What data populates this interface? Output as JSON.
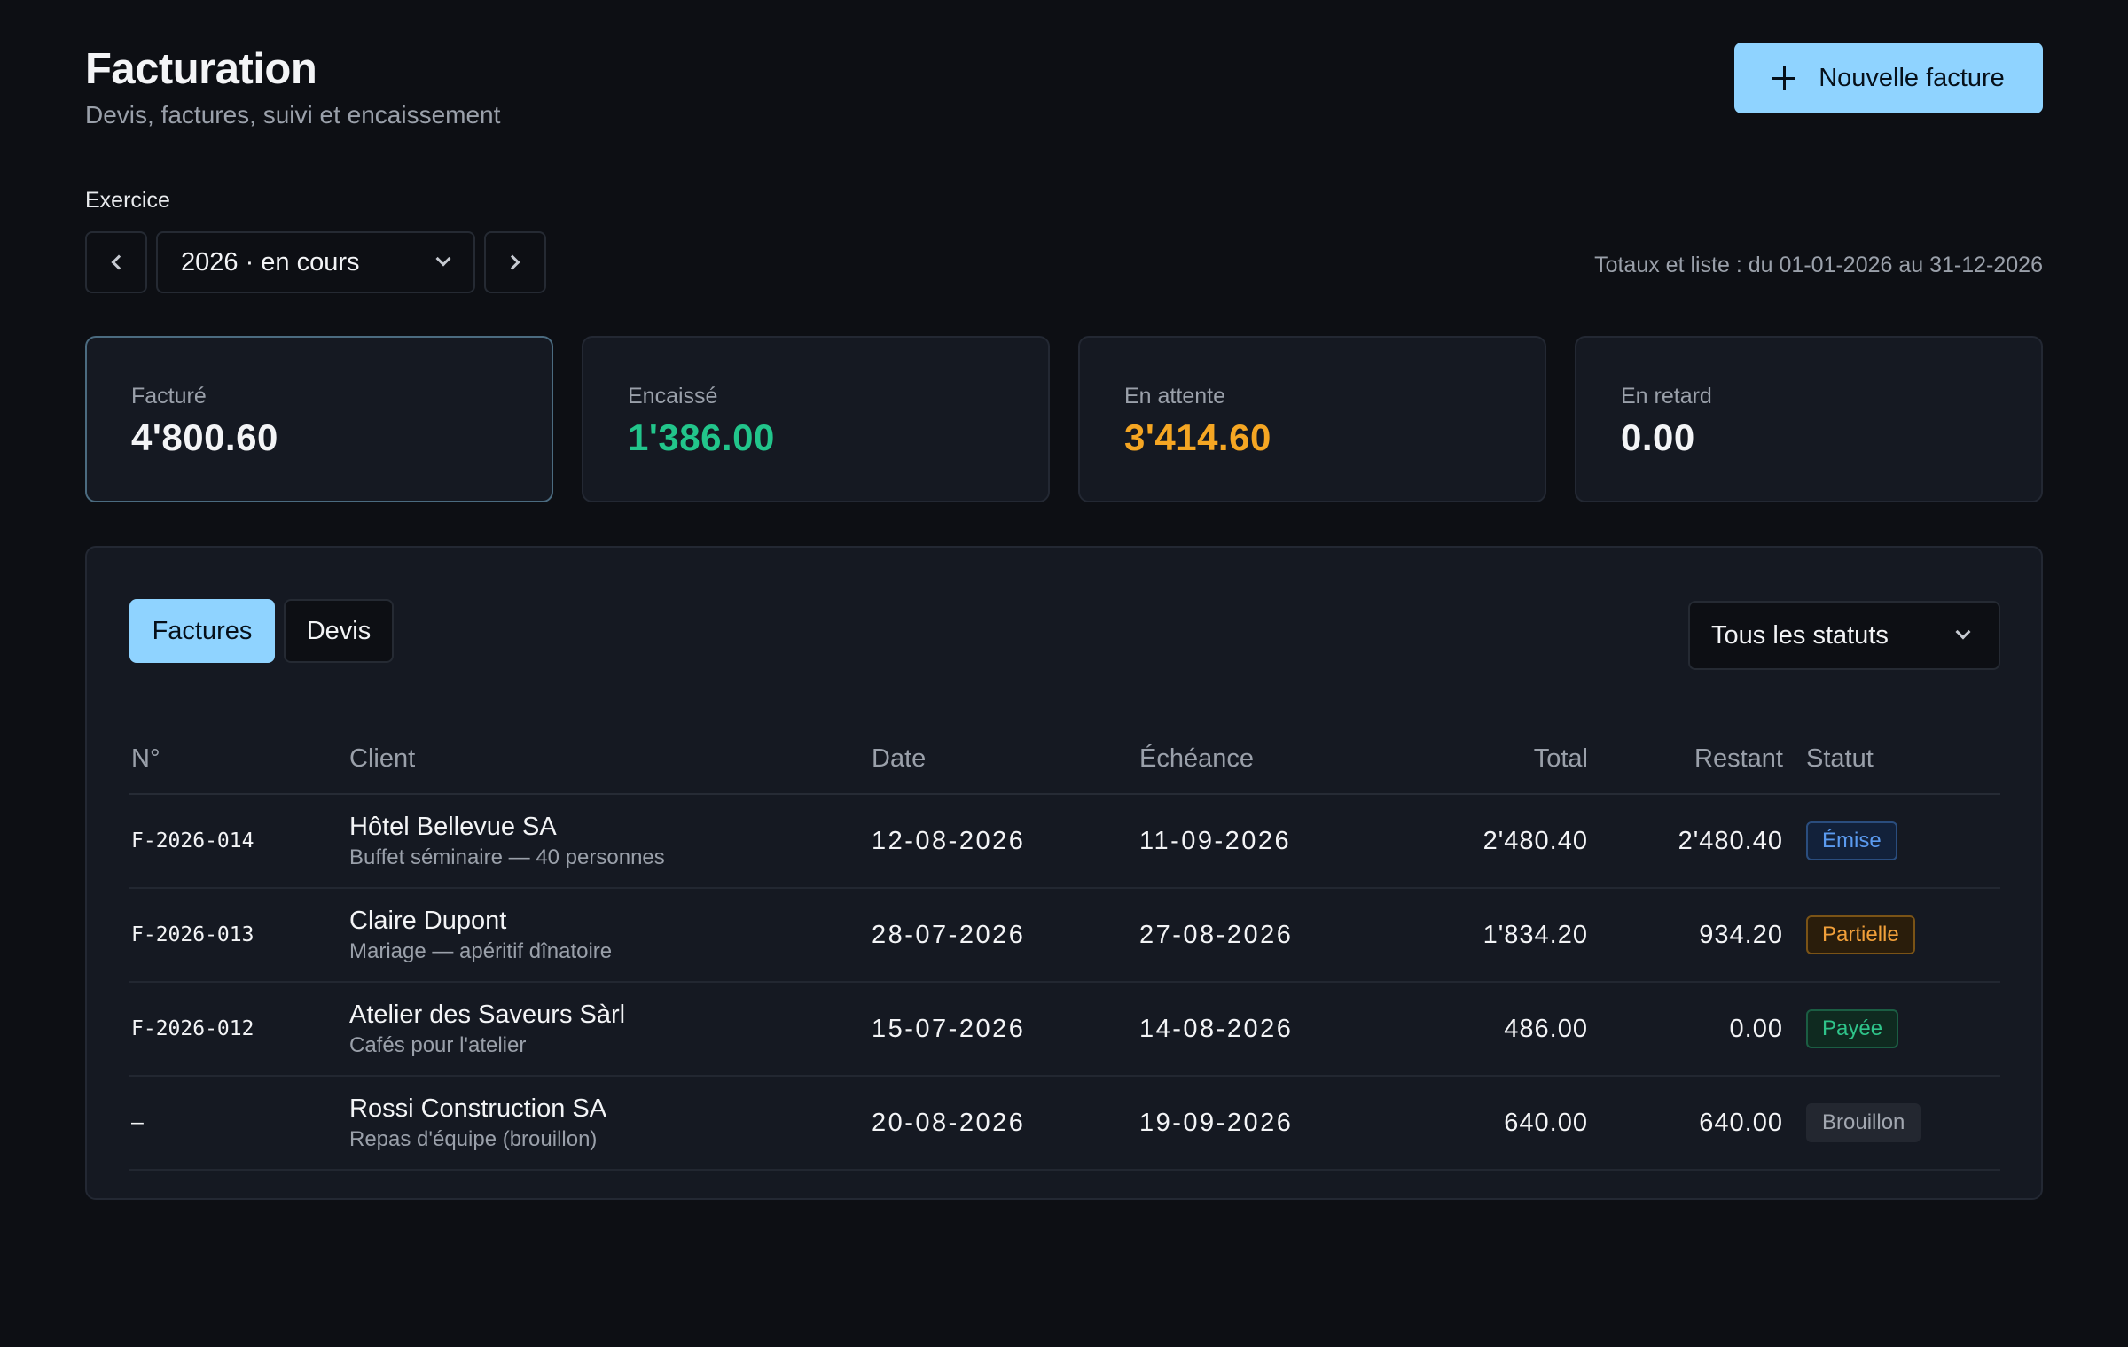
{
  "header": {
    "title": "Facturation",
    "subtitle": "Devis, factures, suivi et encaissement",
    "new_invoice_label": "Nouvelle facture"
  },
  "exercise": {
    "label": "Exercice",
    "selected": "2026 · en cours",
    "period_text": "Totaux et liste : du 01-01-2026 au 31-12-2026"
  },
  "stats": [
    {
      "label": "Facturé",
      "value": "4'800.60",
      "color": "#f3f4f6"
    },
    {
      "label": "Encaissé",
      "value": "1'386.00",
      "color": "#22c58b"
    },
    {
      "label": "En attente",
      "value": "3'414.60",
      "color": "#f5a623"
    },
    {
      "label": "En retard",
      "value": "0.00",
      "color": "#f3f4f6"
    }
  ],
  "tabs": {
    "invoices": "Factures",
    "quotes": "Devis"
  },
  "status_filter": {
    "selected": "Tous les statuts"
  },
  "table": {
    "headers": {
      "no": "N°",
      "client": "Client",
      "date": "Date",
      "due": "Échéance",
      "total": "Total",
      "remaining": "Restant",
      "status": "Statut"
    },
    "rows": [
      {
        "no": "F-2026-014",
        "client": "Hôtel Bellevue SA",
        "desc": "Buffet séminaire — 40 personnes",
        "date": "12-08-2026",
        "due": "11-09-2026",
        "total": "2'480.40",
        "remaining": "2'480.40",
        "status": "Émise"
      },
      {
        "no": "F-2026-013",
        "client": "Claire Dupont",
        "desc": "Mariage — apéritif dînatoire",
        "date": "28-07-2026",
        "due": "27-08-2026",
        "total": "1'834.20",
        "remaining": "934.20",
        "status": "Partielle"
      },
      {
        "no": "F-2026-012",
        "client": "Atelier des Saveurs Sàrl",
        "desc": "Cafés pour l'atelier",
        "date": "15-07-2026",
        "due": "14-08-2026",
        "total": "486.00",
        "remaining": "0.00",
        "status": "Payée"
      },
      {
        "no": "–",
        "client": "Rossi Construction SA",
        "desc": "Repas d'équipe (brouillon)",
        "date": "20-08-2026",
        "due": "19-09-2026",
        "total": "640.00",
        "remaining": "640.00",
        "status": "Brouillon"
      }
    ]
  }
}
